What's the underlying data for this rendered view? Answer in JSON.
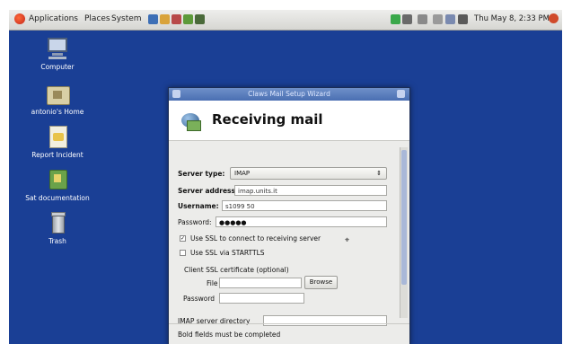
{
  "panel": {
    "menus": [
      "Applications",
      "Places",
      "System"
    ],
    "clock": "Thu May 8, 2:33 PM"
  },
  "desktop": {
    "icons": [
      {
        "label": "Computer",
        "icon": "computer-icon"
      },
      {
        "label": "antonio's Home",
        "icon": "home-folder-icon"
      },
      {
        "label": "Report Incident",
        "icon": "report-icon"
      },
      {
        "label": "Sat documentation",
        "icon": "documentation-icon"
      },
      {
        "label": "Trash",
        "icon": "trash-icon"
      }
    ]
  },
  "dialog": {
    "title": "Claws Mail Setup Wizard",
    "heading": "Receiving mail",
    "server_type_label": "Server type:",
    "server_type_value": "IMAP",
    "server_address_label": "Server address:",
    "server_address_value": "imap.units.it",
    "username_label": "Username:",
    "username_value": "s1099 50",
    "password_label": "Password:",
    "password_value": "●●●●●",
    "ssl_connect_label": "Use SSL to connect to receiving server",
    "ssl_connect_checked": true,
    "starttls_label": "Use SSL via STARTTLS",
    "starttls_checked": false,
    "client_cert_label": "Client SSL certificate (optional)",
    "file_label": "File",
    "file_value": "",
    "browse_label": "Browse",
    "cert_password_label": "Password",
    "cert_password_value": "",
    "imap_dir_label": "IMAP server directory",
    "imap_dir_value": "",
    "footer": "Bold fields must be completed"
  }
}
